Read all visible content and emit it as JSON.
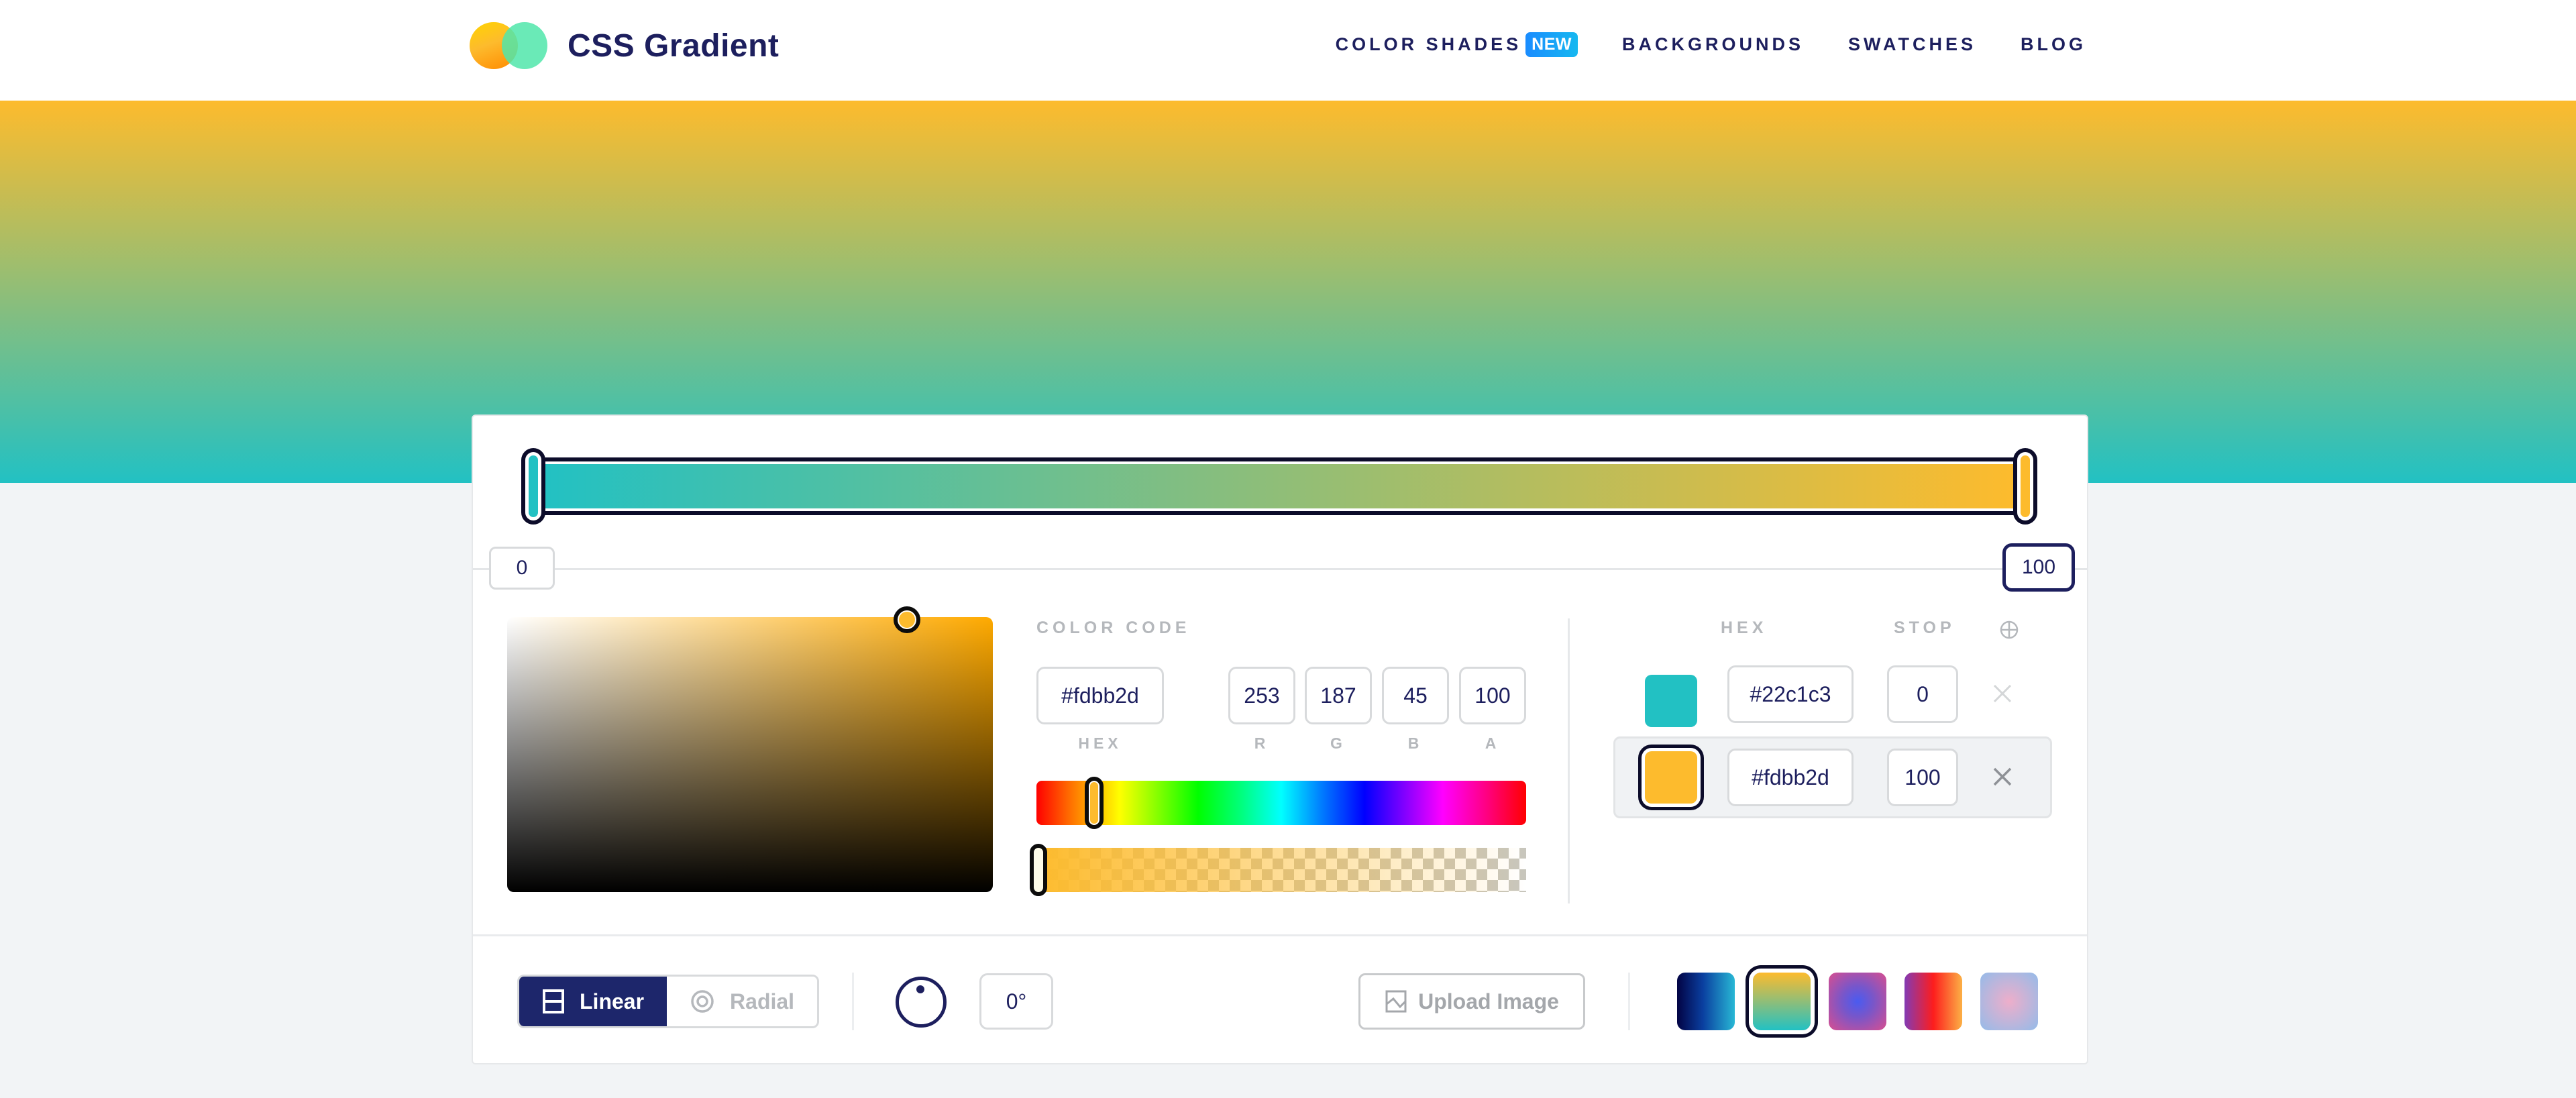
{
  "header": {
    "brand": "CSS Gradient",
    "nav": [
      {
        "label": "COLOR SHADES",
        "badge": "NEW"
      },
      {
        "label": "BACKGROUNDS"
      },
      {
        "label": "SWATCHES"
      },
      {
        "label": "BLOG"
      }
    ]
  },
  "gradient": {
    "type": "linear",
    "angle_deg": 0,
    "stops": [
      {
        "hex": "#22c1c3",
        "position": 0
      },
      {
        "hex": "#fdbb2d",
        "position": 100
      }
    ],
    "stop_inputs": {
      "left": "0",
      "right": "100"
    }
  },
  "color_code": {
    "label": "COLOR CODE",
    "hex": "#fdbb2d",
    "r": "253",
    "g": "187",
    "b": "45",
    "a": "100",
    "labels": {
      "hex": "HEX",
      "r": "R",
      "g": "G",
      "b": "B",
      "a": "A"
    },
    "hue_deg": 41,
    "alpha_percent": 100
  },
  "stops_panel": {
    "headers": {
      "hex": "HEX",
      "stop": "STOP"
    },
    "add_icon": "circle-plus-icon",
    "rows": [
      {
        "color": "#22c1c3",
        "hex": "#22c1c3",
        "stop": "0",
        "selected": false
      },
      {
        "color": "#fdbb2d",
        "hex": "#fdbb2d",
        "stop": "100",
        "selected": true
      }
    ]
  },
  "toolbar": {
    "linear_label": "Linear",
    "radial_label": "Radial",
    "active_type": "Linear",
    "angle": "0°",
    "upload_label": "Upload Image",
    "presets": [
      {
        "name": "navy-cyan",
        "selected": false
      },
      {
        "name": "gold-teal",
        "selected": true
      },
      {
        "name": "pink-blue-radial",
        "selected": false
      },
      {
        "name": "purple-red-orange",
        "selected": false
      },
      {
        "name": "lavender-pink-radial",
        "selected": false
      }
    ]
  },
  "colors": {
    "navy": "#1d1f5e",
    "active_button": "#1d266b",
    "new_badge": "#1a8cff",
    "muted_label": "#b5b8bc"
  }
}
